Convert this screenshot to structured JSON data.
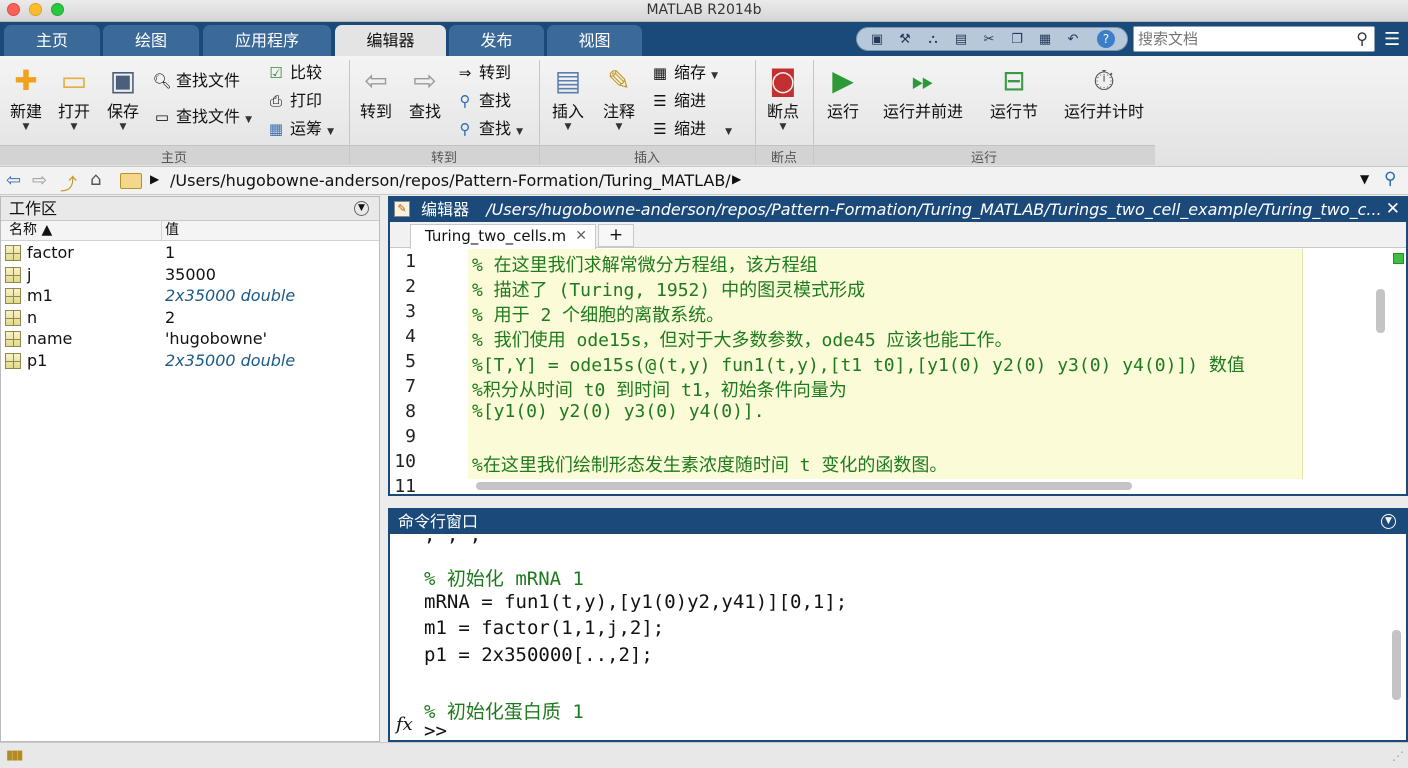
{
  "window": {
    "title": "MATLAB R2014b"
  },
  "tabs": [
    {
      "label": "主页",
      "active": false
    },
    {
      "label": "绘图",
      "active": false
    },
    {
      "label": "应用程序",
      "active": false
    },
    {
      "label": "编辑器",
      "active": true
    },
    {
      "label": "发布",
      "active": false
    },
    {
      "label": "视图",
      "active": false
    }
  ],
  "search": {
    "placeholder": "搜索文档"
  },
  "ribbon": {
    "file": {
      "new": "新建",
      "open": "打开",
      "save": "保存",
      "find_files_1": "查找文件",
      "find_files_2": "查找文件",
      "compare": "比较",
      "print": "打印",
      "transport": "运筹",
      "group": "主页"
    },
    "navigate": {
      "goto_big": "转到",
      "find_big": "查找",
      "goto_small": "转到",
      "find_small_1": "查找",
      "find_small_2": "查找",
      "group": "转到"
    },
    "edit": {
      "insert": "插入",
      "comment": "注释",
      "indent": "缩存",
      "indent2": "缩进",
      "indent3": "缩进",
      "group": "插入"
    },
    "breakpoints": {
      "label": "断点",
      "group": "断点"
    },
    "run": {
      "run": "运行",
      "run_advance": "运行并前进",
      "run_section": "运行节",
      "run_time": "运行并计时",
      "group": "运行"
    }
  },
  "address": {
    "path": "/Users/hugobowne-anderson/repos/Pattern-Formation/Turing_MATLAB/"
  },
  "workspace": {
    "title": "工作区",
    "col_name": "名称 ▲",
    "col_value": "值",
    "vars": [
      {
        "name": "factor",
        "value": "1",
        "italic": false
      },
      {
        "name": "j",
        "value": "35000",
        "italic": false
      },
      {
        "name": "m1",
        "value": "2x35000 double",
        "italic": true
      },
      {
        "name": "n",
        "value": "2",
        "italic": false
      },
      {
        "name": "name",
        "value": "'hugobowne'",
        "italic": false
      },
      {
        "name": "p1",
        "value": "2x35000 double",
        "italic": true
      }
    ]
  },
  "editor": {
    "label": "编辑器",
    "path": "/Users/hugobowne-anderson/repos/Pattern-Formation/Turing_MATLAB/Turings_two_cell_example/Turing_two_c...",
    "tab": "Turing_two_cells.m",
    "add_tab": "+",
    "lines": [
      {
        "n": "1",
        "text": "% 在这里我们求解常微分方程组，该方程组"
      },
      {
        "n": "2",
        "text": "% 描述了 (Turing, 1952) 中的图灵模式形成"
      },
      {
        "n": "3",
        "text": "% 用于 2 个细胞的离散系统。"
      },
      {
        "n": "4",
        "text": "% 我们使用 ode15s，但对于大多数参数，ode45 应该也能工作。"
      },
      {
        "n": "5",
        "text": "%[T,Y] = ode15s(@(t,y) fun1(t,y),[t1 t0],[y1(0) y2(0) y3(0) y4(0)]) 数值"
      },
      {
        "n": "7",
        "text": "%积分从时间 t0 到时间 t1，初始条件向量为"
      },
      {
        "n": "8",
        "text": "%[y1(0) y2(0) y3(0) y4(0)]."
      },
      {
        "n": "9",
        "text": ""
      },
      {
        "n": "10",
        "text": "%在这里我们绘制形态发生素浓度随时间 t 变化的函数图。"
      },
      {
        "n": "11",
        "text": ""
      }
    ]
  },
  "command": {
    "title": "命令行窗口",
    "partial": ", , ,",
    "lines": [
      {
        "text": "% 初始化 mRNA 1",
        "color": "#1e7a1e"
      },
      {
        "text": "mRNA = fun1(t,y),[y1(0)y2,y41)][0,1];",
        "color": "#111111"
      },
      {
        "text": "m1 = factor(1,1,j,2];",
        "color": "#111111"
      },
      {
        "text": "p1 = 2x350000[..,2];",
        "color": "#111111"
      },
      {
        "text": "",
        "color": "#111111"
      },
      {
        "text": "% 初始化蛋白质 1",
        "color": "#1e7a1e"
      }
    ],
    "fx": "fx",
    "prompt": ">>"
  }
}
